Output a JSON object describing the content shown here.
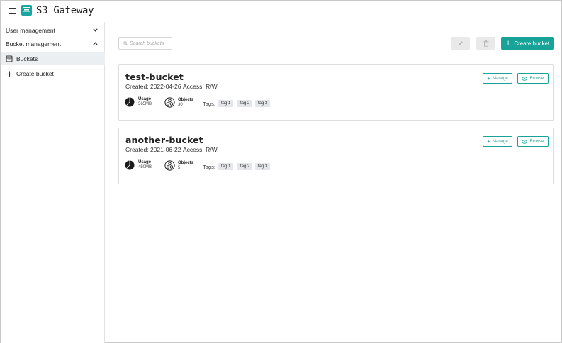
{
  "app": {
    "title": "S3 Gateway"
  },
  "sidebar": {
    "items": [
      {
        "label": "User management",
        "chevron": "chevron-down-icon"
      },
      {
        "label": "Bucket management",
        "chevron": "chevron-up-icon"
      },
      {
        "label": "Buckets",
        "icon": "bucket-icon",
        "active": true
      },
      {
        "label": "Create bucket",
        "icon": "plus-icon"
      }
    ]
  },
  "toolbar": {
    "search_placeholder": "Search buckets",
    "create_label": "Create bucket"
  },
  "buckets": [
    {
      "name": "test-bucket",
      "created": "Created: 2022-04-26",
      "access": "Access: R/W",
      "usage_label": "Usage",
      "usage_value": "365MB",
      "objects_label": "Objects",
      "objects_value": "30",
      "tags_label": "Tags:",
      "tags": [
        "tag 1",
        "tag 2",
        "tag 3"
      ],
      "manage_label": "Manage",
      "browse_label": "Browse"
    },
    {
      "name": "another-bucket",
      "created": "Created: 2021-06-22",
      "access": "Access: R/W",
      "usage_label": "Usage",
      "usage_value": "450MB",
      "objects_label": "Objects",
      "objects_value": "5",
      "tags_label": "Tags:",
      "tags": [
        "tag 1",
        "tag 2",
        "tag 3"
      ],
      "manage_label": "Manage",
      "browse_label": "Browse"
    }
  ],
  "colors": {
    "accent": "#17a398",
    "logo": "#1aa6a0",
    "active_bg": "#eceff2",
    "tag_bg": "#e4e6ea"
  }
}
